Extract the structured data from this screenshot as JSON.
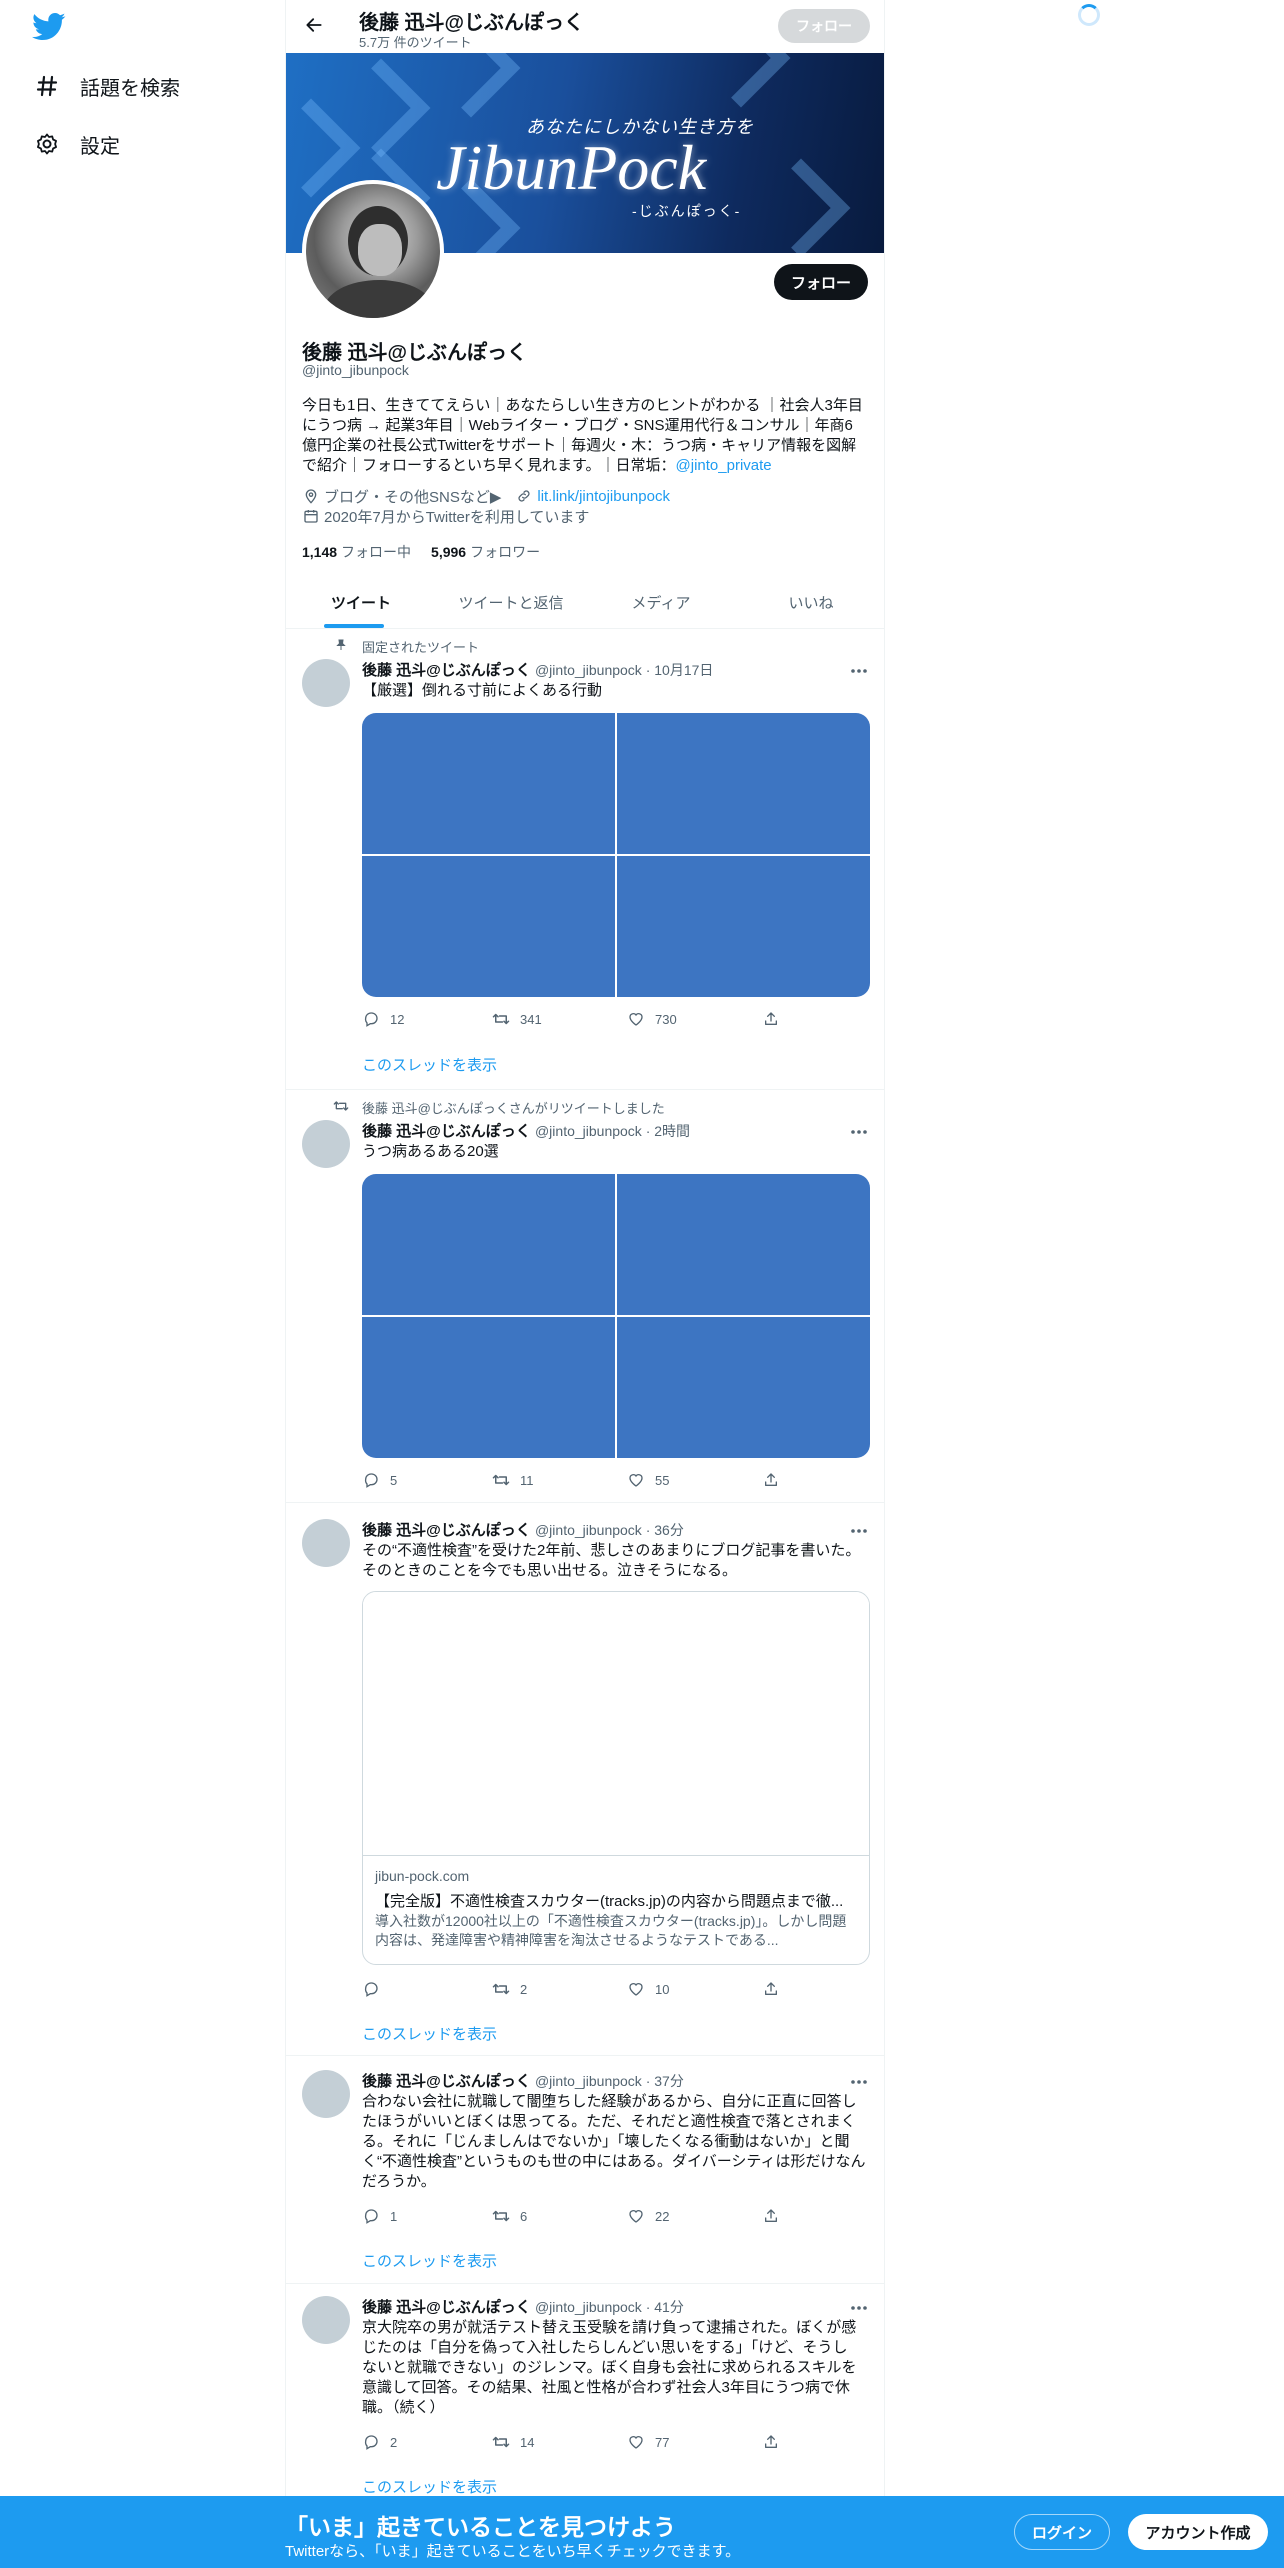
{
  "colors": {
    "accent": "#1d9bf0",
    "media_placeholder": "#3d75c2",
    "avatar_placeholder": "#c4cfd6"
  },
  "sidebar": {
    "items": [
      {
        "icon": "hashtag-icon",
        "label": "話題を検索"
      },
      {
        "icon": "gear-icon",
        "label": "設定"
      }
    ]
  },
  "header": {
    "title": "後藤 迅斗@じぶんぽっく",
    "subtitle": "5.7万 件のツイート",
    "follow_label": "フォロー"
  },
  "banner": {
    "tagline": "あなたにしかない生き方を",
    "title": "JibunPock",
    "kana": "-じぶんぽっく-"
  },
  "profile": {
    "follow_label": "フォロー",
    "name": "後藤 迅斗@じぶんぽっく",
    "handle": "@jinto_jibunpock",
    "bio_lines": [
      "今日も1日、生きててえらい｜あなたらしい生き方のヒントがわかる ｜社会人3年目",
      "にうつ病 → 起業3年目｜Webライター・ブログ・SNS運用代行＆コンサル｜年商6",
      "億円企業の社長公式Twitterをサポート｜毎週火・木：うつ病・キャリア情報を図解",
      "で紹介｜フォローするといち早く見れます。｜日常垢："
    ],
    "bio_link": "@jinto_private",
    "location": "ブログ・その他SNSなど▶",
    "url": "lit.link/jintojibunpock",
    "joined": "2020年7月からTwitterを利用しています",
    "following_count": "1,148",
    "following_label": "フォロー中",
    "followers_count": "5,996",
    "followers_label": "フォロワー"
  },
  "tabs": [
    {
      "label": "ツイート",
      "active": true
    },
    {
      "label": "ツイートと返信",
      "active": false
    },
    {
      "label": "メディア",
      "active": false
    },
    {
      "label": "いいね",
      "active": false
    }
  ],
  "tweets": [
    {
      "social": "固定されたツイート",
      "name": "後藤 迅斗@じぶんぽっく",
      "handle": "@jinto_jibunpock",
      "time": "10月17日",
      "text": "【厳選】倒れる寸前によくある行動",
      "reply": "12",
      "retweet": "341",
      "like": "730",
      "thread": "このスレッドを表示"
    },
    {
      "social": "後藤 迅斗@じぶんぽっくさんがリツイートしました",
      "name": "後藤 迅斗@じぶんぽっく",
      "handle": "@jinto_jibunpock",
      "time": "2時間",
      "text": "うつ病あるある20選",
      "reply": "5",
      "retweet": "11",
      "like": "55"
    },
    {
      "name": "後藤 迅斗@じぶんぽっく",
      "handle": "@jinto_jibunpock",
      "time": "36分",
      "text_lines": [
        "その“不適性検査”を受けた2年前、悲しさのあまりにブログ記事を書いた。",
        "そのときのことを今でも思い出せる。泣きそうになる。"
      ],
      "card": {
        "domain": "jibun-pock.com",
        "title": "【完全版】不適性検査スカウター(tracks.jp)の内容から問題点まで徹...",
        "desc": "導入社数が12000社以上の「不適性検査スカウター(tracks.jp)」。しかし問題内容は、発達障害や精神障害を淘汰させるようなテストである..."
      },
      "reply": "",
      "retweet": "2",
      "like": "10",
      "thread": "このスレッドを表示"
    },
    {
      "name": "後藤 迅斗@じぶんぽっく",
      "handle": "@jinto_jibunpock",
      "time": "37分",
      "text_lines": [
        "合わない会社に就職して闇堕ちした経験があるから、自分に正直に回答し",
        "たほうがいいとぼくは思ってる。ただ、それだと適性検査で落とされまく",
        "る。それに「じんましんはでないか」「壊したくなる衝動はないか」と聞",
        "く“不適性検査”というものも世の中にはある。ダイバーシティは形だけなん",
        "だろうか。"
      ],
      "reply": "1",
      "retweet": "6",
      "like": "22",
      "thread": "このスレッドを表示"
    },
    {
      "name": "後藤 迅斗@じぶんぽっく",
      "handle": "@jinto_jibunpock",
      "time": "41分",
      "text_lines": [
        "京大院卒の男が就活テスト替え玉受験を請け負って逮捕された。ぼくが感",
        "じたのは「自分を偽って入社したらしんどい思いをする」「けど、そうし",
        "ないと就職できない」のジレンマ。ぼく自身も会社に求められるスキルを",
        "意識して回答。その結果、社風と性格が合わず社会人3年目にうつ病で休",
        "職。（続く）"
      ],
      "reply": "2",
      "retweet": "14",
      "like": "77",
      "thread": "このスレッドを表示"
    }
  ],
  "bottom_bar": {
    "title": "「いま」起きていることを見つけよう",
    "subtitle": "Twitterなら、「いま」起きていることをいち早くチェックできます。",
    "login_label": "ログイン",
    "signup_label": "アカウント作成"
  }
}
